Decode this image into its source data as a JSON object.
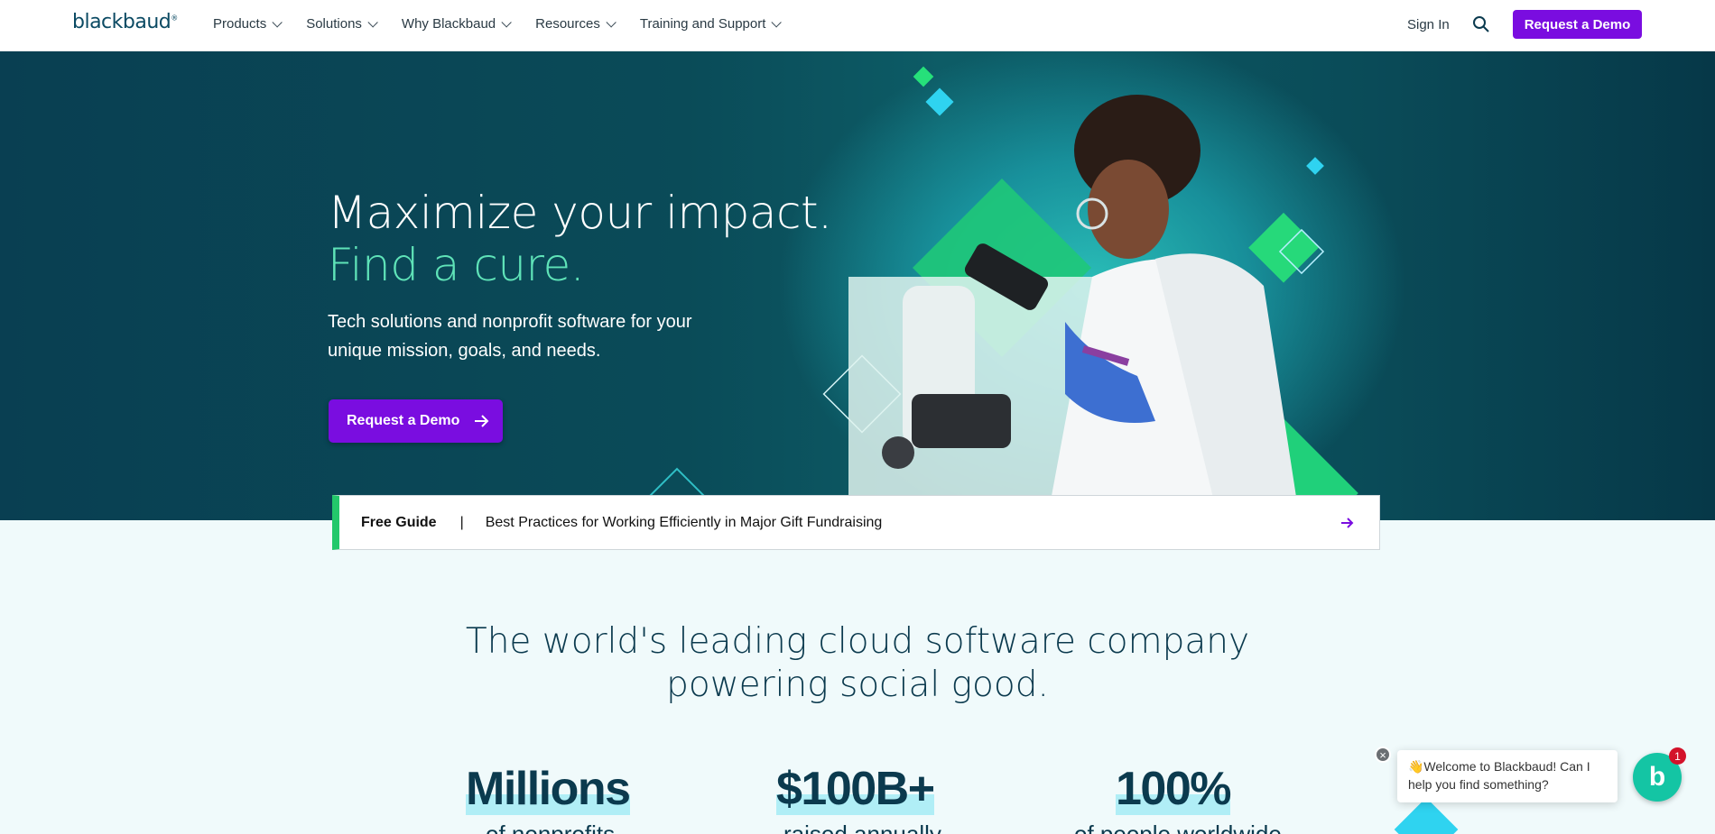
{
  "nav": {
    "logo": "blackbaud",
    "logo_mark": "®",
    "menu": [
      {
        "label": "Products"
      },
      {
        "label": "Solutions"
      },
      {
        "label": "Why Blackbaud"
      },
      {
        "label": "Resources"
      },
      {
        "label": "Training and Support"
      }
    ],
    "sign_in": "Sign In",
    "search_icon": "search-icon",
    "demo_button": "Request a Demo"
  },
  "hero": {
    "title_line1": "Maximize your impact.",
    "title_line2": "Find a cure.",
    "subtitle": "Tech solutions and nonprofit software for your unique mission, goals, and needs.",
    "cta": "Request a Demo",
    "image": "scientist-with-microscope"
  },
  "guide": {
    "tag": "Free Guide",
    "separator": "|",
    "text": "Best Practices for Working Efficiently in Major Gift Fundraising"
  },
  "section": {
    "title_line1": "The world's leading cloud software company",
    "title_line2": "powering social good.",
    "stats": [
      {
        "value": "Millions",
        "caption": "of nonprofits"
      },
      {
        "value": "$100B+",
        "caption": "raised annually"
      },
      {
        "value": "100%",
        "caption": "of people worldwide"
      }
    ]
  },
  "chat": {
    "message": "👋Welcome to Blackbaud! Can I help you find something?",
    "badge": "1",
    "close": "×",
    "button_glyph": "b"
  },
  "colors": {
    "brand_purple": "#7a0de0",
    "hero_teal": "#0a4b58",
    "accent_green": "#5fe3b8",
    "guide_green": "#23c86b"
  }
}
